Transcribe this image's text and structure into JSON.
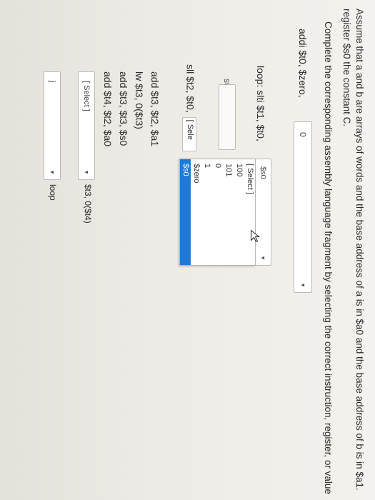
{
  "question": {
    "line1": "Assume that a and b are arrays of words and the base address of a is in $a0 and the base address of b is in $a1.",
    "line2": "register $s0 the constant C.",
    "line3": "Complete the corresponding assembly language fragment by selecting the correct instruction, register, or value"
  },
  "code": {
    "addi": "addi $t0, $zero,",
    "addi_value": "0",
    "loop": "loop: slti $t1, $t0,",
    "loop_select": "$s0",
    "sw": "sw",
    "sll": "sll $t2, $t0,",
    "sll_select": "[ Sele",
    "line_add1": "add $t3, $t2, $a1",
    "line_lw": "lw $t3, 0($t3)",
    "line_add2": "add $t3, $t3, $s0",
    "line_add3": "add $t4, $t2, $a0",
    "select_bottom": "[ Select ]",
    "sw_target": "$t3, 0($t4)",
    "j_prefix": "j",
    "loop_label": "loop"
  },
  "menu": {
    "items": [
      "[ Select ]",
      "100",
      "101",
      "0",
      "1",
      "$zero",
      "$s0"
    ],
    "selected_index": 6
  },
  "taskbar": {
    "icons": [
      "start-icon",
      "task-view-icon",
      "edge-icon",
      "file-explorer-icon",
      "store-icon",
      "mail-icon",
      "chrome-icon",
      "chrome-icon-2",
      "spotify-icon",
      "photos-icon",
      "powerpoint-icon"
    ],
    "colors": {
      "edge": "#2b8fd9",
      "explorer": "#f0c23b",
      "store": "#2f7dd1",
      "mail": "#3a79c9",
      "chrome": "#e3443a",
      "spotify": "#1db954",
      "ppt": "#d24726"
    }
  }
}
